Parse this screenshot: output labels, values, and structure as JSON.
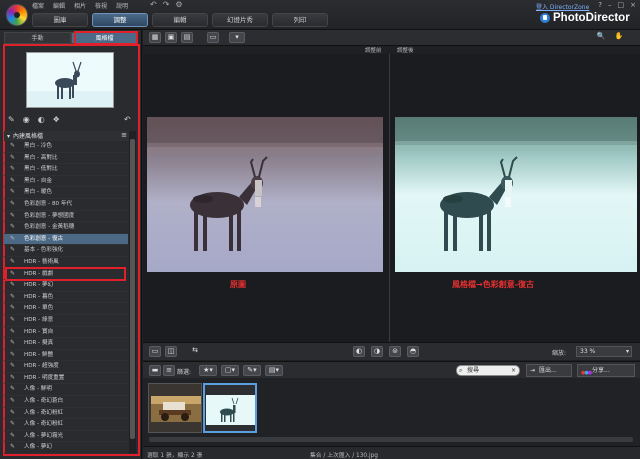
{
  "menu": {
    "items": [
      "檔案",
      "編輯",
      "相片",
      "檢視",
      "說明"
    ],
    "undo_icons": [
      "↶",
      "↷",
      "⚙"
    ]
  },
  "tabs": [
    {
      "label": "圖庫",
      "active": false
    },
    {
      "label": "調整",
      "active": true
    },
    {
      "label": "編輯",
      "active": false
    },
    {
      "label": "幻燈片秀",
      "active": false
    },
    {
      "label": "列印",
      "active": false
    }
  ],
  "window": {
    "login": "登入 DirectorZone",
    "brand": "PhotoDirector",
    "controls": [
      "?",
      "–",
      "□",
      "×"
    ]
  },
  "left_panel": {
    "tabs": [
      {
        "label": "手動",
        "active": false
      },
      {
        "label": "風格檔",
        "active": true
      }
    ],
    "tool_icons": [
      "✎",
      "◉",
      "◐",
      "❖"
    ],
    "reset_icon": "↶",
    "presets_header": "內建風格檔",
    "presets_menu_icon": "≡",
    "presets": [
      {
        "label": "黑白 - 冷色",
        "selected": false
      },
      {
        "label": "黑白 - 高對比",
        "selected": false
      },
      {
        "label": "黑白 - 低對比",
        "selected": false
      },
      {
        "label": "黑白 - 自金",
        "selected": false
      },
      {
        "label": "黑白 - 暖色",
        "selected": false
      },
      {
        "label": "色彩創意 - 80 年代",
        "selected": false
      },
      {
        "label": "色彩創意 - 夢想國度",
        "selected": false
      },
      {
        "label": "色彩創意 - 金黃稻穗",
        "selected": false
      },
      {
        "label": "色彩創意 - 復古",
        "selected": true
      },
      {
        "label": "基本 - 色彩強化",
        "selected": false
      },
      {
        "label": "HDR - 藝術風",
        "selected": false
      },
      {
        "label": "HDR - 戲劇",
        "selected": false
      },
      {
        "label": "HDR - 夢幻",
        "selected": false
      },
      {
        "label": "HDR - 暮色",
        "selected": false
      },
      {
        "label": "HDR - 單色",
        "selected": false
      },
      {
        "label": "HDR - 綠意",
        "selected": false
      },
      {
        "label": "HDR - 寶自",
        "selected": false
      },
      {
        "label": "HDR - 擬真",
        "selected": false
      },
      {
        "label": "HDR - 鮮艷",
        "selected": false
      },
      {
        "label": "HDR - 超強度",
        "selected": false
      },
      {
        "label": "HDR - 明度重置",
        "selected": false
      },
      {
        "label": "人像 - 鮮明",
        "selected": false
      },
      {
        "label": "人像 - 奇幻蒼白",
        "selected": false
      },
      {
        "label": "人像 - 奇幻粉紅",
        "selected": false
      },
      {
        "label": "人像 - 奇幻粉紅",
        "selected": false
      },
      {
        "label": "人像 - 夢幻霧光",
        "selected": false
      },
      {
        "label": "人像 - 夢幻",
        "selected": false
      }
    ]
  },
  "viewer": {
    "toolbar_icons": [
      "▦",
      "▣",
      "▤",
      "▭",
      "▾"
    ],
    "right_tools": [
      "🔍",
      "✋"
    ],
    "before_label": "調整前",
    "after_label": "調整後",
    "caption_before": "原圖",
    "caption_after": "風格檔→色彩創意-復古",
    "zoom_label": "縮放:",
    "zoom_value": "33 %"
  },
  "filmstrip": {
    "filter_label": "篩選:",
    "search_placeholder": "搜尋",
    "export_label": "匯出...",
    "share_label": "分享...",
    "thumbs": [
      {
        "name": "thumb-1",
        "selected": false
      },
      {
        "name": "thumb-2",
        "selected": true
      }
    ]
  },
  "status": {
    "left": "選取 1 張，顯示 2 張",
    "right": "集合 / 上次匯入 / 130.jpg"
  }
}
